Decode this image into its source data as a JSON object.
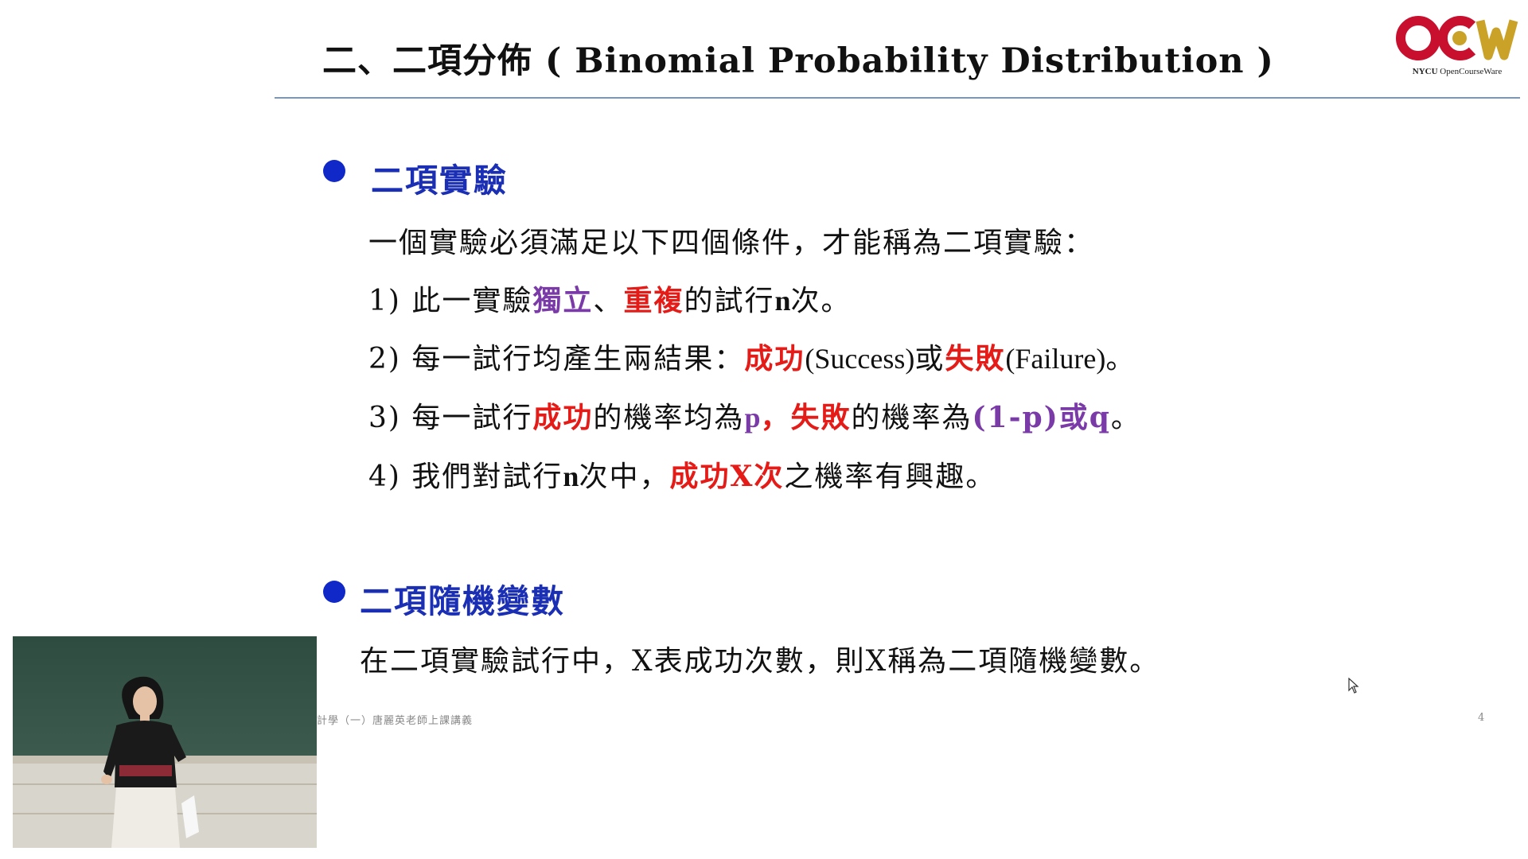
{
  "slide": {
    "title": "二、二項分佈 ( Binomial Probability Distribution )",
    "logo": {
      "brand": "OCW",
      "caption_org": "NYCU",
      "caption_name": "OpenCourseWare",
      "colors": {
        "red": "#c8102e",
        "gold": "#c9a227"
      }
    },
    "section1": {
      "heading": "二項實驗",
      "intro": "一個實驗必須滿足以下四個條件，才能稱為二項實驗：",
      "cond1": {
        "a": "1) 此一實驗",
        "b": "獨立",
        "c": "、",
        "d": "重複",
        "e": "的試行",
        "f": "n",
        "g": "次。"
      },
      "cond2": {
        "a": "2) 每一試行均產生兩結果：",
        "b": "成功",
        "c": "(Success)",
        "d": "或",
        "e": "失敗",
        "f": "(Failure)",
        "g": "。"
      },
      "cond3": {
        "a": "3) 每一試行",
        "b": "成功",
        "c": "的機率均為",
        "d": "p",
        "e": "，",
        "f": "失敗",
        "g": "的機率為",
        "h": "(1-p)或q",
        "i": "。"
      },
      "cond4": {
        "a": "4) 我們對試行",
        "b": "n",
        "c": "次中，",
        "d": "成功X次",
        "e": "之機率有興趣。"
      }
    },
    "section2": {
      "heading": "二項隨機變數",
      "text": "在二項實驗試行中，X表成功次數，則X稱為二項隨機變數。"
    },
    "footer": {
      "left": "計學（一）唐麗英老師上課講義",
      "page": "4"
    }
  },
  "colors": {
    "heading_blue": "#1b2fb5",
    "bullet_blue": "#1028c8",
    "emphasis_red": "#e41b17",
    "emphasis_purple": "#7a3aa8",
    "rule": "#7f96b2"
  },
  "video": {
    "label": "lecturer-camera"
  }
}
